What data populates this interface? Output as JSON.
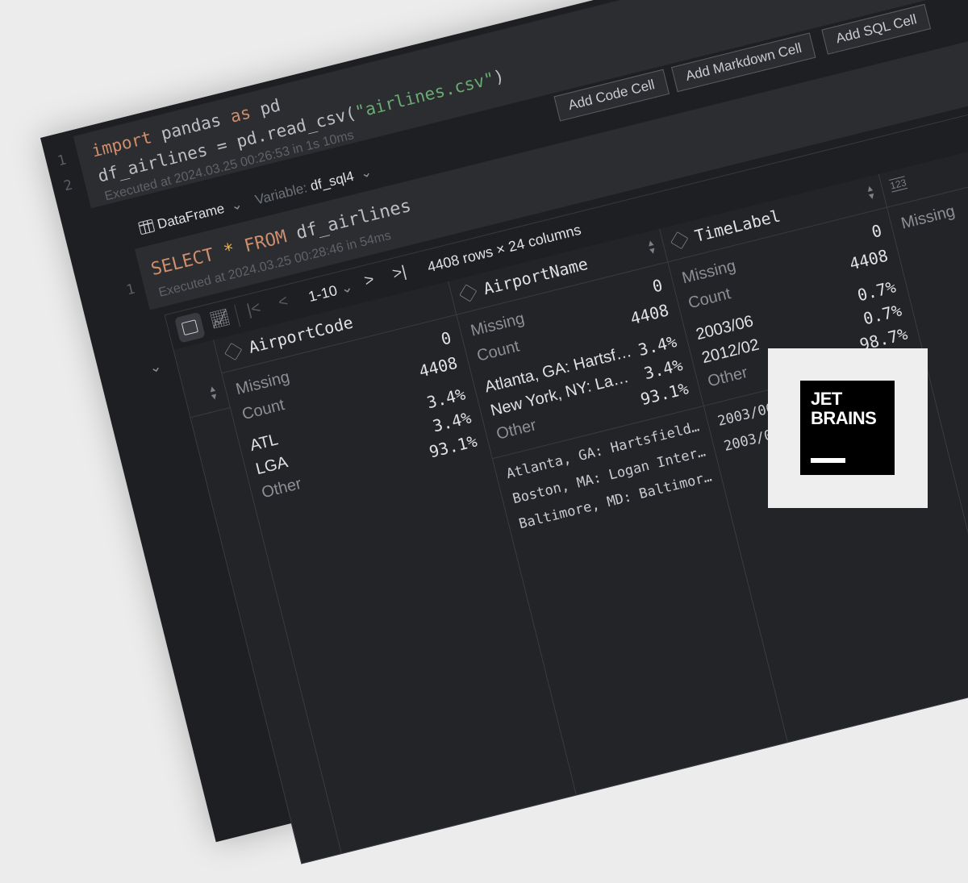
{
  "code_cell": {
    "line_numbers": [
      "1",
      "2"
    ],
    "line1": {
      "kw1": "import",
      "mid": " pandas ",
      "kw2": "as",
      "end": " pd"
    },
    "line2": {
      "start": "df_airlines = pd.read_csv(",
      "string": "\"airlines.csv\"",
      "end": ")"
    },
    "executed": "Executed at 2024.03.25 00:26:53 in 1s 10ms"
  },
  "add_buttons": [
    "Add Code Cell",
    "Add Markdown Cell",
    "Add SQL Cell"
  ],
  "sql_cell": {
    "output_type": "DataFrame",
    "variable_label": "Variable:",
    "variable_value": "df_sql4",
    "line_number": "1",
    "query": {
      "kw1": "SELECT",
      "star": " * ",
      "kw2": "FROM",
      "rest": " df_airlines"
    },
    "executed": "Executed at 2024.03.25 00:28:46 in 54ms"
  },
  "table_toolbar": {
    "page_range": "1-10",
    "summary": "4408 rows × 24 columns"
  },
  "columns": [
    {
      "name": "AirportCode",
      "missing_label": "Missing",
      "missing": "0",
      "count_label": "Count",
      "count": "4408",
      "top": [
        {
          "label": "ATL",
          "pct": "3.4%"
        },
        {
          "label": "LGA",
          "pct": "3.4%"
        },
        {
          "label": "Other",
          "pct": "93.1%"
        }
      ],
      "rows": []
    },
    {
      "name": "AirportName",
      "missing_label": "Missing",
      "missing": "0",
      "count_label": "Count",
      "count": "4408",
      "top": [
        {
          "label": "Atlanta, GA: Hartsf…",
          "pct": "3.4%"
        },
        {
          "label": "New York, NY: La…",
          "pct": "3.4%"
        },
        {
          "label": "Other",
          "pct": "93.1%"
        }
      ],
      "rows": [
        "Atlanta, GA: Hartsfield…",
        "Boston, MA: Logan Inter…",
        "Baltimore, MD: Baltimor…"
      ]
    },
    {
      "name": "TimeLabel",
      "missing_label": "Missing",
      "missing": "0",
      "count_label": "Count",
      "count": "4408",
      "top": [
        {
          "label": "2003/06",
          "pct": "0.7%"
        },
        {
          "label": "2012/02",
          "pct": "0.7%"
        },
        {
          "label": "Other",
          "pct": "98.7%"
        }
      ],
      "rows": [
        "2003/06",
        "2003/06"
      ]
    },
    {
      "type_icon": "123",
      "missing_label": "Missing"
    }
  ],
  "logo": {
    "line1": "JET",
    "line2": "BRAINS"
  },
  "colors": {
    "keyword": "#cf8e6d",
    "string": "#6aab73",
    "background": "#1e1f22",
    "cell": "#2b2d30"
  }
}
